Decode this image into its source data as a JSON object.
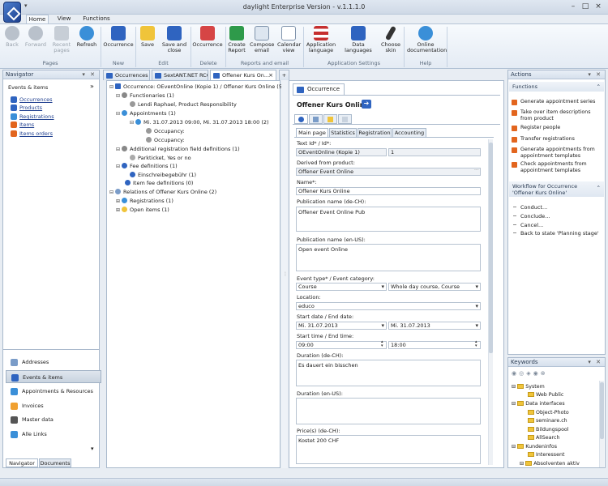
{
  "window": {
    "title": "daylight Enterprise Version - v.1.1.1.0"
  },
  "ribbon_tabs": [
    "Home",
    "View",
    "Functions"
  ],
  "ribbon": {
    "groups": [
      {
        "label": "Pages"
      },
      {
        "label": "New"
      },
      {
        "label": "Edit"
      },
      {
        "label": "Delete"
      },
      {
        "label": "Reports and email"
      },
      {
        "label": "Application Settings"
      },
      {
        "label": "Help"
      }
    ],
    "buttons": {
      "back": "Back",
      "forward": "Forward",
      "recent_pages": "Recent pages",
      "refresh": "Refresh",
      "new_occurrence": "Occurrence",
      "save": "Save",
      "save_close": "Save and close",
      "delete_occurrence": "Occurrence",
      "create_report": "Create Report",
      "compose_email": "Compose email",
      "calendar_view": "Calendar view",
      "app_language": "Application language",
      "data_languages": "Data languages",
      "choose_skin": "Choose skin",
      "online_docs": "Online documentation"
    }
  },
  "navigator": {
    "title": "Navigator",
    "section_title": "Events & items",
    "links": [
      "Occurrences",
      "Products",
      "Registrations",
      "Items",
      "Items orders"
    ],
    "bar_items": [
      "Addresses",
      "Events & items",
      "Appointments & Resources",
      "Invoices",
      "Master data",
      "Alle Links"
    ],
    "bottom_tabs": [
      "Navigator",
      "Documents"
    ]
  },
  "doc_tabs": [
    "Occurrences",
    "SextANT.NET RCO",
    "Offener Kurs On..."
  ],
  "tree": {
    "root": "Occurrence: OEventOnline (Kopie 1) / Offener Kurs Online (5)",
    "functionaries": "Functionaries (1)",
    "functionary_1": "Lendi Raphael, Product Responsibility",
    "appointments": "Appointments (1)",
    "appointment_1": "Mi. 31.07.2013 09:00, Mi. 31.07.2013 18:00 (2)",
    "occupancy_1": "Occupancy:",
    "occupancy_2": "Occupancy:",
    "additional_fields": "Additional registration field definitions (1)",
    "parking": "Parkticket, Yes or no",
    "fee_definitions": "Fee definitions (1)",
    "fee_1": "Einschreibegebühr (1)",
    "item_fee": "Item fee definitions (0)",
    "relations": "Relations of Offener Kurs Online (2)",
    "registrations": "Registrations (1)",
    "open_items": "Open items (1)"
  },
  "detail": {
    "tab_title": "Occurrence",
    "heading": "Offener Kurs Online",
    "sub_tabs": [
      "Main page",
      "Statistics",
      "Registration",
      "Accounting"
    ],
    "fields": {
      "text_id_label": "Text Id* / Id*:",
      "text_id_value": "OEventOnline (Kopie 1)",
      "id_value": "1",
      "derived_label": "Derived from product:",
      "derived_value": "Offener Event Online",
      "name_label": "Name*:",
      "name_value": "Offener Kurs Online",
      "pub_de_label": "Publication name (de-CH):",
      "pub_de_value": "Offener Event Online Pub",
      "pub_en_label": "Publication name (en-US):",
      "pub_en_value": "Open event Online",
      "type_label": "Event type* / Event category:",
      "type_value": "Course",
      "category_value": "Whole day course, Course",
      "location_label": "Location:",
      "location_value": "educo",
      "date_label": "Start date / End date:",
      "start_date": "Mi. 31.07.2013",
      "end_date": "Mi. 31.07.2013",
      "time_label": "Start time / End time:",
      "start_time": "09:00",
      "end_time": "18:00",
      "dur_de_label": "Duration (de-CH):",
      "dur_de_value": "Es dauert ein bisschen",
      "dur_en_label": "Duration (en-US):",
      "dur_en_value": "",
      "price_label": "Price(s) (de-CH):",
      "price_value": "Kostet 200 CHF"
    }
  },
  "actions": {
    "title": "Actions",
    "functions_title": "Functions",
    "functions": [
      "Generate appointment series",
      "Take over item descriptions from product",
      "Register people",
      "Transfer registrations",
      "Generate appointments from appointment templates",
      "Check appointments from appointment templates"
    ],
    "workflow_title": "Workflow for Occurrence 'Offener Kurs Online'",
    "workflow": [
      "Conduct...",
      "Conclude...",
      "Cancel...",
      "Back to state 'Planning stage'"
    ]
  },
  "keywords": {
    "title": "Keywords",
    "items": [
      "System",
      "Web Public",
      "Data interfaces",
      "Object-Photo",
      "seminare.ch",
      "Bildungspool",
      "AllSearch",
      "Kundeninfos",
      "Interessent",
      "Absolventen aktiv"
    ]
  },
  "colors": {
    "accent": "#2f64c0",
    "action_icon": "#e2651e",
    "folder": "#f0c43a"
  }
}
